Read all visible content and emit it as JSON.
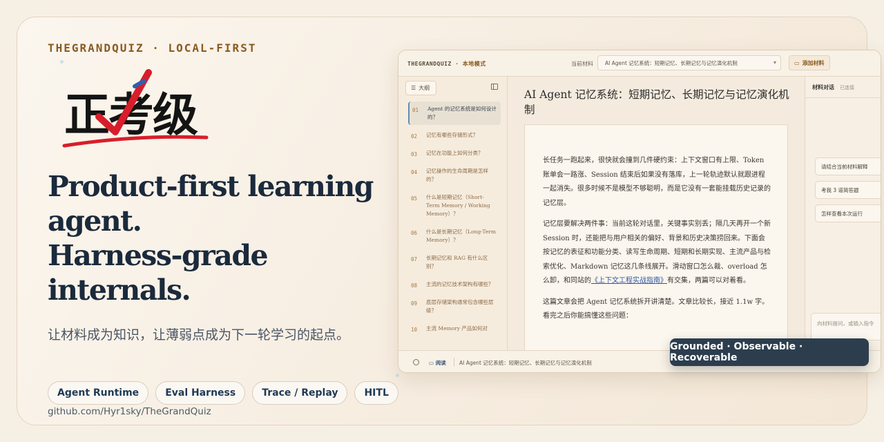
{
  "hero": {
    "kicker": "THEGRANDQUIZ · LOCAL-FIRST",
    "logo_text": "正考级",
    "headline_1": "Product-first learning",
    "headline_2": "agent.",
    "headline_3": "Harness-grade",
    "headline_4": "internals.",
    "subline": "让材料成为知识，让薄弱点成为下一轮学习的起点。",
    "chips": [
      "Agent Runtime",
      "Eval Harness",
      "Trace / Replay",
      "HITL"
    ],
    "repo": "github.com/Hyr1sky/TheGrandQuiz",
    "tagline": "Grounded · Observable · Recoverable"
  },
  "app": {
    "brand": "THEGRANDQUIZ",
    "mode": "本地模式",
    "current_material_label": "当前材料",
    "material_select": "AI Agent 记忆系统：短期记忆、长期记忆与记忆演化机制",
    "add_material": "添加材料",
    "outline_button": "大纲",
    "outline": [
      {
        "num": "01",
        "text": "Agent 的记忆系统是如何设计的？"
      },
      {
        "num": "02",
        "text": "记忆有哪些存储形式？"
      },
      {
        "num": "03",
        "text": "记忆在功能上如何分类？"
      },
      {
        "num": "04",
        "text": "记忆操作的生命周期是怎样的？"
      },
      {
        "num": "05",
        "text": "什么是短期记忆（Short-Term Memory / Working Memory）？"
      },
      {
        "num": "06",
        "text": "什么是长期记忆（Long-Term Memory）？"
      },
      {
        "num": "07",
        "text": "长期记忆和 RAG 有什么区别？"
      },
      {
        "num": "08",
        "text": "主流的记忆技术架构有哪些？"
      },
      {
        "num": "09",
        "text": "底层存储架构通常包含哪些层级？"
      },
      {
        "num": "10",
        "text": "主流 Memory 产品如何对"
      }
    ],
    "doc_title": "AI Agent 记忆系统：短期记忆、长期记忆与记忆演化机制",
    "doc_p1": "长任务一跑起来，很快就会撞到几件硬约束：上下文窗口有上限、Token 账单会一路涨、Session 结束后如果没有落库，上一轮轨迹默认就跟进程一起消失。很多时候不是模型不够聪明，而是它没有一套能挂载历史记录的记忆层。",
    "doc_p2_a": "记忆层要解决两件事：当前这轮对话里，关键事实别丢；隔几天再开一个新 Session 时，还能把与用户相关的偏好、背景和历史决策捞回来。下面会按记忆的表征和功能分类、读写生命周期、短期和长期实现、主流产品与检索优化、Markdown 记忆这几条线展开。滑动窗口怎么裁、overload 怎么卸，和同站的",
    "doc_p2_link": "《上下文工程实战指南》",
    "doc_p2_b": "有交集，两篇可以对着看。",
    "doc_p3": "这篇文章会把 Agent 记忆系统拆开讲清楚。文章比较长，接近 1.1w 字。看完之后你能搞懂这些问题：",
    "chat_title": "材料对话",
    "chat_status": "已连接",
    "suggestions": [
      "请结合当前材料解释",
      "考我 3 道简答题",
      "怎样查看本次运行"
    ],
    "chat_placeholder": "向材料提问，或输入指令",
    "status_read": "阅读",
    "status_title": "AI Agent 记忆系统：短期记忆、长期记忆与记忆演化机制"
  }
}
